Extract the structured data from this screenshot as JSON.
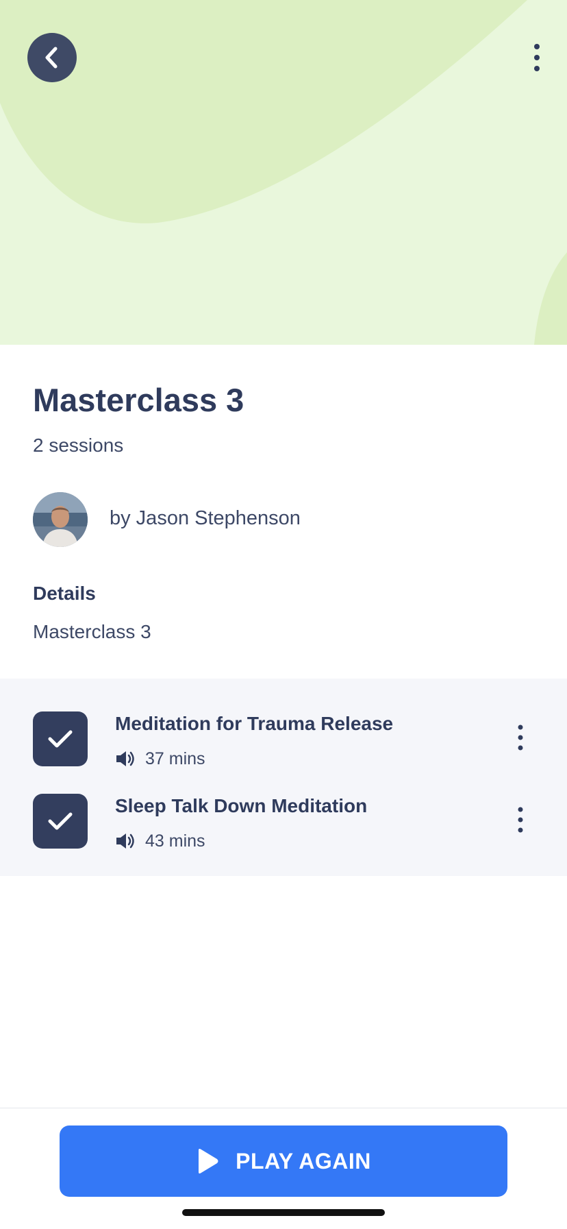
{
  "hero": {
    "background_color": "#e9f7dc",
    "blob_color": "#dcefc2"
  },
  "nav": {
    "back_icon": "chevron-left-icon",
    "menu_icon": "more-vertical-icon"
  },
  "course": {
    "title": "Masterclass 3",
    "session_count": "2 sessions",
    "author": "by Jason Stephenson",
    "details_heading": "Details",
    "details_text": "Masterclass 3"
  },
  "sessions": [
    {
      "title": "Meditation for Trauma Release",
      "duration": "37 mins",
      "completed": true
    },
    {
      "title": "Sleep Talk Down Meditation",
      "duration": "43 mins",
      "completed": true
    }
  ],
  "footer": {
    "play_label": "PLAY AGAIN",
    "play_icon": "play-icon",
    "button_color": "#3478f6"
  },
  "colors": {
    "primary_text": "#2f3b5c",
    "check_box": "#333e5e",
    "back_button": "#3f4a66"
  }
}
